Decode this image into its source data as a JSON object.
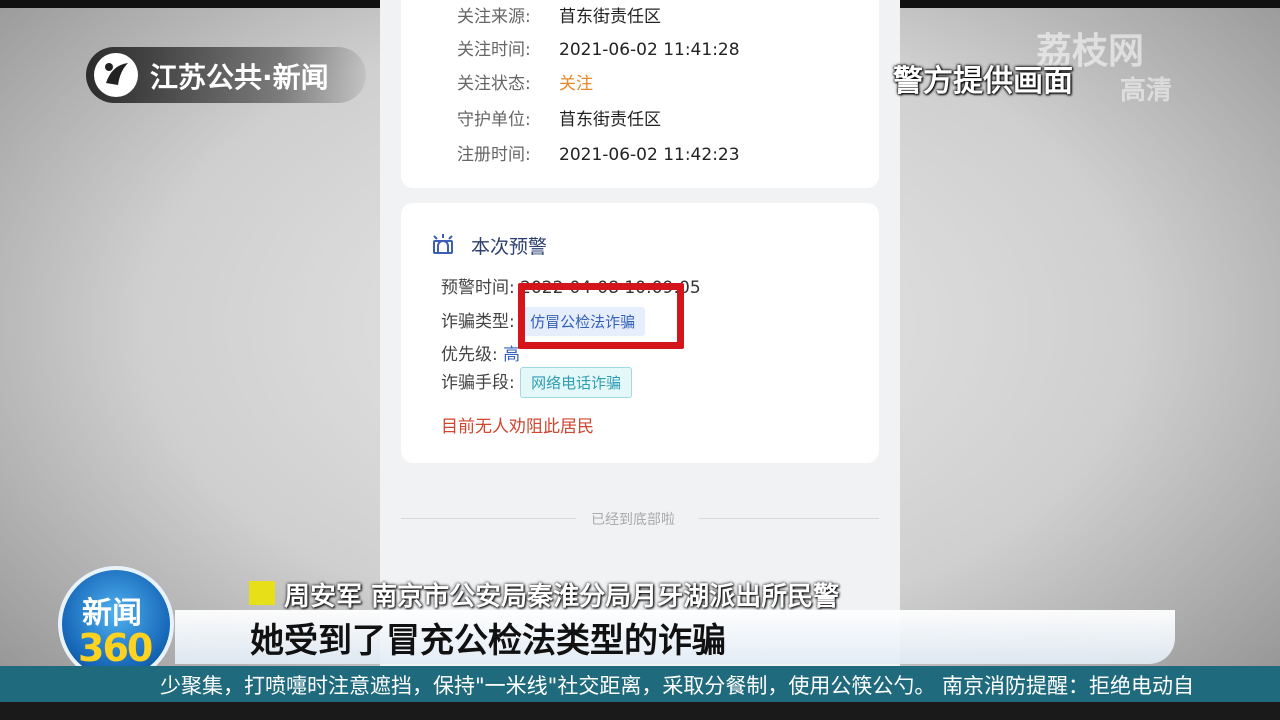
{
  "broadcast": {
    "channel_logo": "江苏公共·新闻",
    "source_note": "警方提供画面",
    "watermark": "荔枝网",
    "watermark_sub": "高清",
    "program_badge_line1": "新闻",
    "program_badge_line2": "360",
    "speaker_name": "周安军",
    "speaker_title": "南京市公安局秦淮分局月牙湖派出所民警",
    "caption": "她受到了冒充公检法类型的诈骗",
    "ticker": "少聚集，打喷嚏时注意遮挡，保持\"一米线\"社交距离，采取分餐制，使用公筷公勺。 南京消防提醒：拒绝电动自"
  },
  "info_card": {
    "rows": [
      {
        "label": "关注来源:",
        "value": "苜东街责任区"
      },
      {
        "label": "关注时间:",
        "value": "2021-06-02 11:41:28"
      },
      {
        "label": "关注状态:",
        "value": "关注"
      },
      {
        "label": "守护单位:",
        "value": "苜东街责任区"
      },
      {
        "label": "注册时间:",
        "value": "2021-06-02 11:42:23"
      }
    ]
  },
  "warning_card": {
    "title": "本次预警",
    "time_label": "预警时间:",
    "time_value": "2022-04-08 10:09:05",
    "fraud_type_label": "诈骗类型:",
    "fraud_type_tag": "仿冒公检法诈骗",
    "priority_label": "优先级:",
    "priority_value": "高",
    "method_label": "诈骗手段:",
    "method_tag": "网络电话诈骗",
    "status_text": "目前无人劝阻此居民"
  },
  "footer": {
    "end_text": "已经到底部啦"
  },
  "colors": {
    "status_orange": "#e8892a",
    "alert_red": "#d0462f",
    "highlight_red": "#d4161c",
    "ticker_bg": "#1f6a7c",
    "tag_blue": "#3461b8",
    "tag_cyan": "#2e9fb3"
  }
}
